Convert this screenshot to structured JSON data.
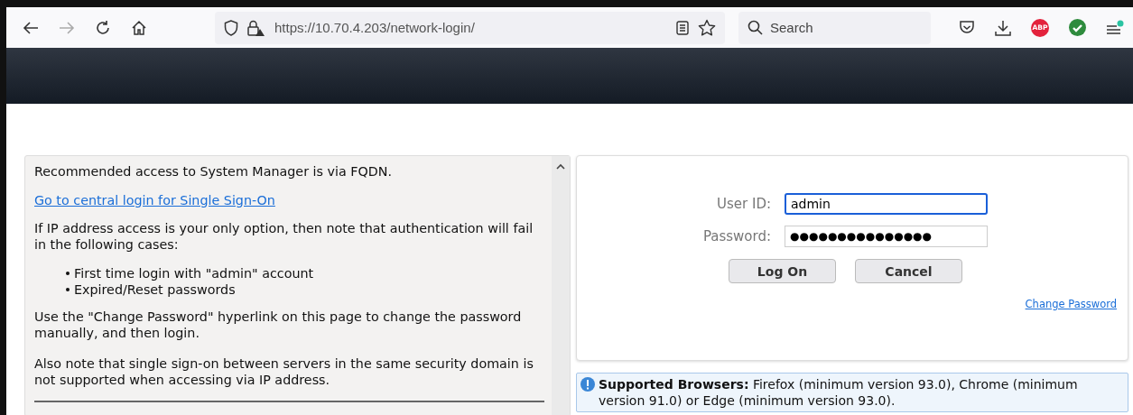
{
  "browser": {
    "url": "https://10.70.4.203/network-login/",
    "search_placeholder": "Search",
    "adblock_badge": "ABP",
    "menu_notification": true,
    "forward_disabled": true
  },
  "info_panel": {
    "intro": "Recommended access to System Manager is via FQDN.",
    "sso_link": "Go to central login for Single Sign-On",
    "ip_note": "If IP address access is your only option, then note that authentication will fail in the following cases:",
    "cases": [
      "First time login with \"admin\" account",
      "Expired/Reset passwords"
    ],
    "change_note": "Use the \"Change Password\" hyperlink on this page to change the password manually, and then login.",
    "sso_note": "Also note that single sign-on between servers in the same security domain is not supported when accessing via IP address."
  },
  "login": {
    "user_label": "User ID:",
    "user_value": "admin",
    "user_focused": true,
    "password_label": "Password:",
    "password_value": "●●●●●●●●●●●●●●●",
    "buttons": [
      "Log On",
      "Cancel"
    ],
    "change_password": "Change Password"
  },
  "notice": {
    "text": "**Supported Browsers:** Firefox (minimum version 93.0), Chrome (minimum version 91.0) or Edge (minimum version 93.0)."
  }
}
